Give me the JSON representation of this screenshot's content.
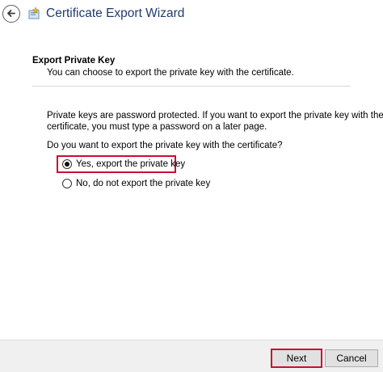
{
  "window": {
    "title": "Certificate Export Wizard"
  },
  "header": {
    "title": "Export Private Key",
    "subtitle": "You can choose to export the private key with the certificate."
  },
  "body": {
    "info_line1": "Private keys are password protected. If you want to export the private key with the",
    "info_line2": "certificate, you must type a password on a later page.",
    "question": "Do you want to export the private key with the certificate?"
  },
  "options": [
    {
      "label": "Yes, export the private key",
      "selected": true
    },
    {
      "label": "No, do not export the private key",
      "selected": false
    }
  ],
  "buttons": {
    "next_label": "Next",
    "cancel_label": "Cancel"
  },
  "colors": {
    "title_text": "#1e3c6e",
    "highlight": "#c8102e",
    "footer_bg": "#f0f0f0"
  },
  "icons": {
    "back": "back-arrow-icon",
    "wizard": "certificate-wizard-icon"
  }
}
